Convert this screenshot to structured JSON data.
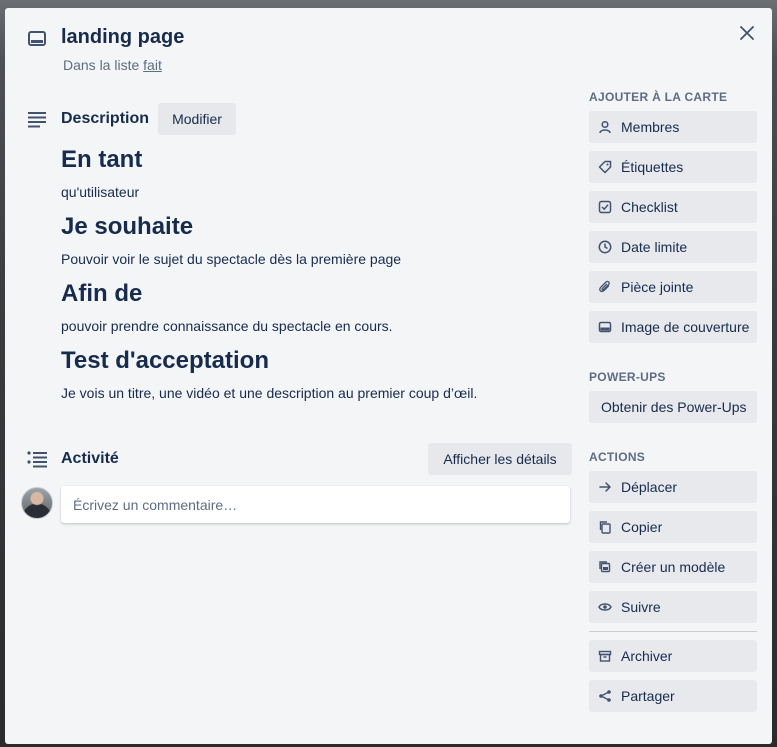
{
  "card": {
    "title": "landing page",
    "list_prefix": "Dans la liste",
    "list_name": "fait"
  },
  "description": {
    "title": "Description",
    "edit_label": "Modifier",
    "content": [
      {
        "type": "h1",
        "text": "En tant"
      },
      {
        "type": "p",
        "text": "qu'utilisateur"
      },
      {
        "type": "h1",
        "text": "Je souhaite"
      },
      {
        "type": "p",
        "text": "Pouvoir voir le sujet du spectacle dès la première page"
      },
      {
        "type": "h1",
        "text": "Afin de"
      },
      {
        "type": "p",
        "text": "pouvoir prendre connaissance du spectacle en cours."
      },
      {
        "type": "h1",
        "text": "Test d'acceptation"
      },
      {
        "type": "p",
        "text": "Je vois un titre, une vidéo et une description au premier coup d’œil."
      }
    ]
  },
  "activity": {
    "title": "Activité",
    "details_label": "Afficher les détails",
    "comment_placeholder": "Écrivez un commentaire…"
  },
  "sidebar": {
    "add_heading": "AJOUTER À LA CARTE",
    "add_items": [
      {
        "label": "Membres",
        "icon": "person-icon"
      },
      {
        "label": "Étiquettes",
        "icon": "tag-icon"
      },
      {
        "label": "Checklist",
        "icon": "checkbox-icon"
      },
      {
        "label": "Date limite",
        "icon": "clock-icon"
      },
      {
        "label": "Pièce jointe",
        "icon": "paperclip-icon"
      },
      {
        "label": "Image de couverture",
        "icon": "cover-icon"
      }
    ],
    "powerups_heading": "POWER-UPS",
    "powerups_button": "Obtenir des Power-Ups",
    "actions_heading": "ACTIONS",
    "actions": [
      {
        "label": "Déplacer",
        "icon": "arrow-right-icon"
      },
      {
        "label": "Copier",
        "icon": "copy-icon"
      },
      {
        "label": "Créer un modèle",
        "icon": "template-icon"
      },
      {
        "label": "Suivre",
        "icon": "eye-icon"
      },
      {
        "label": "Archiver",
        "icon": "archive-icon"
      },
      {
        "label": "Partager",
        "icon": "share-icon"
      }
    ]
  },
  "colors": {
    "modal_bg": "#f4f5f7",
    "button_bg": "#e7e9ed",
    "text_primary": "#172b4d",
    "text_secondary": "#5e6c84"
  }
}
